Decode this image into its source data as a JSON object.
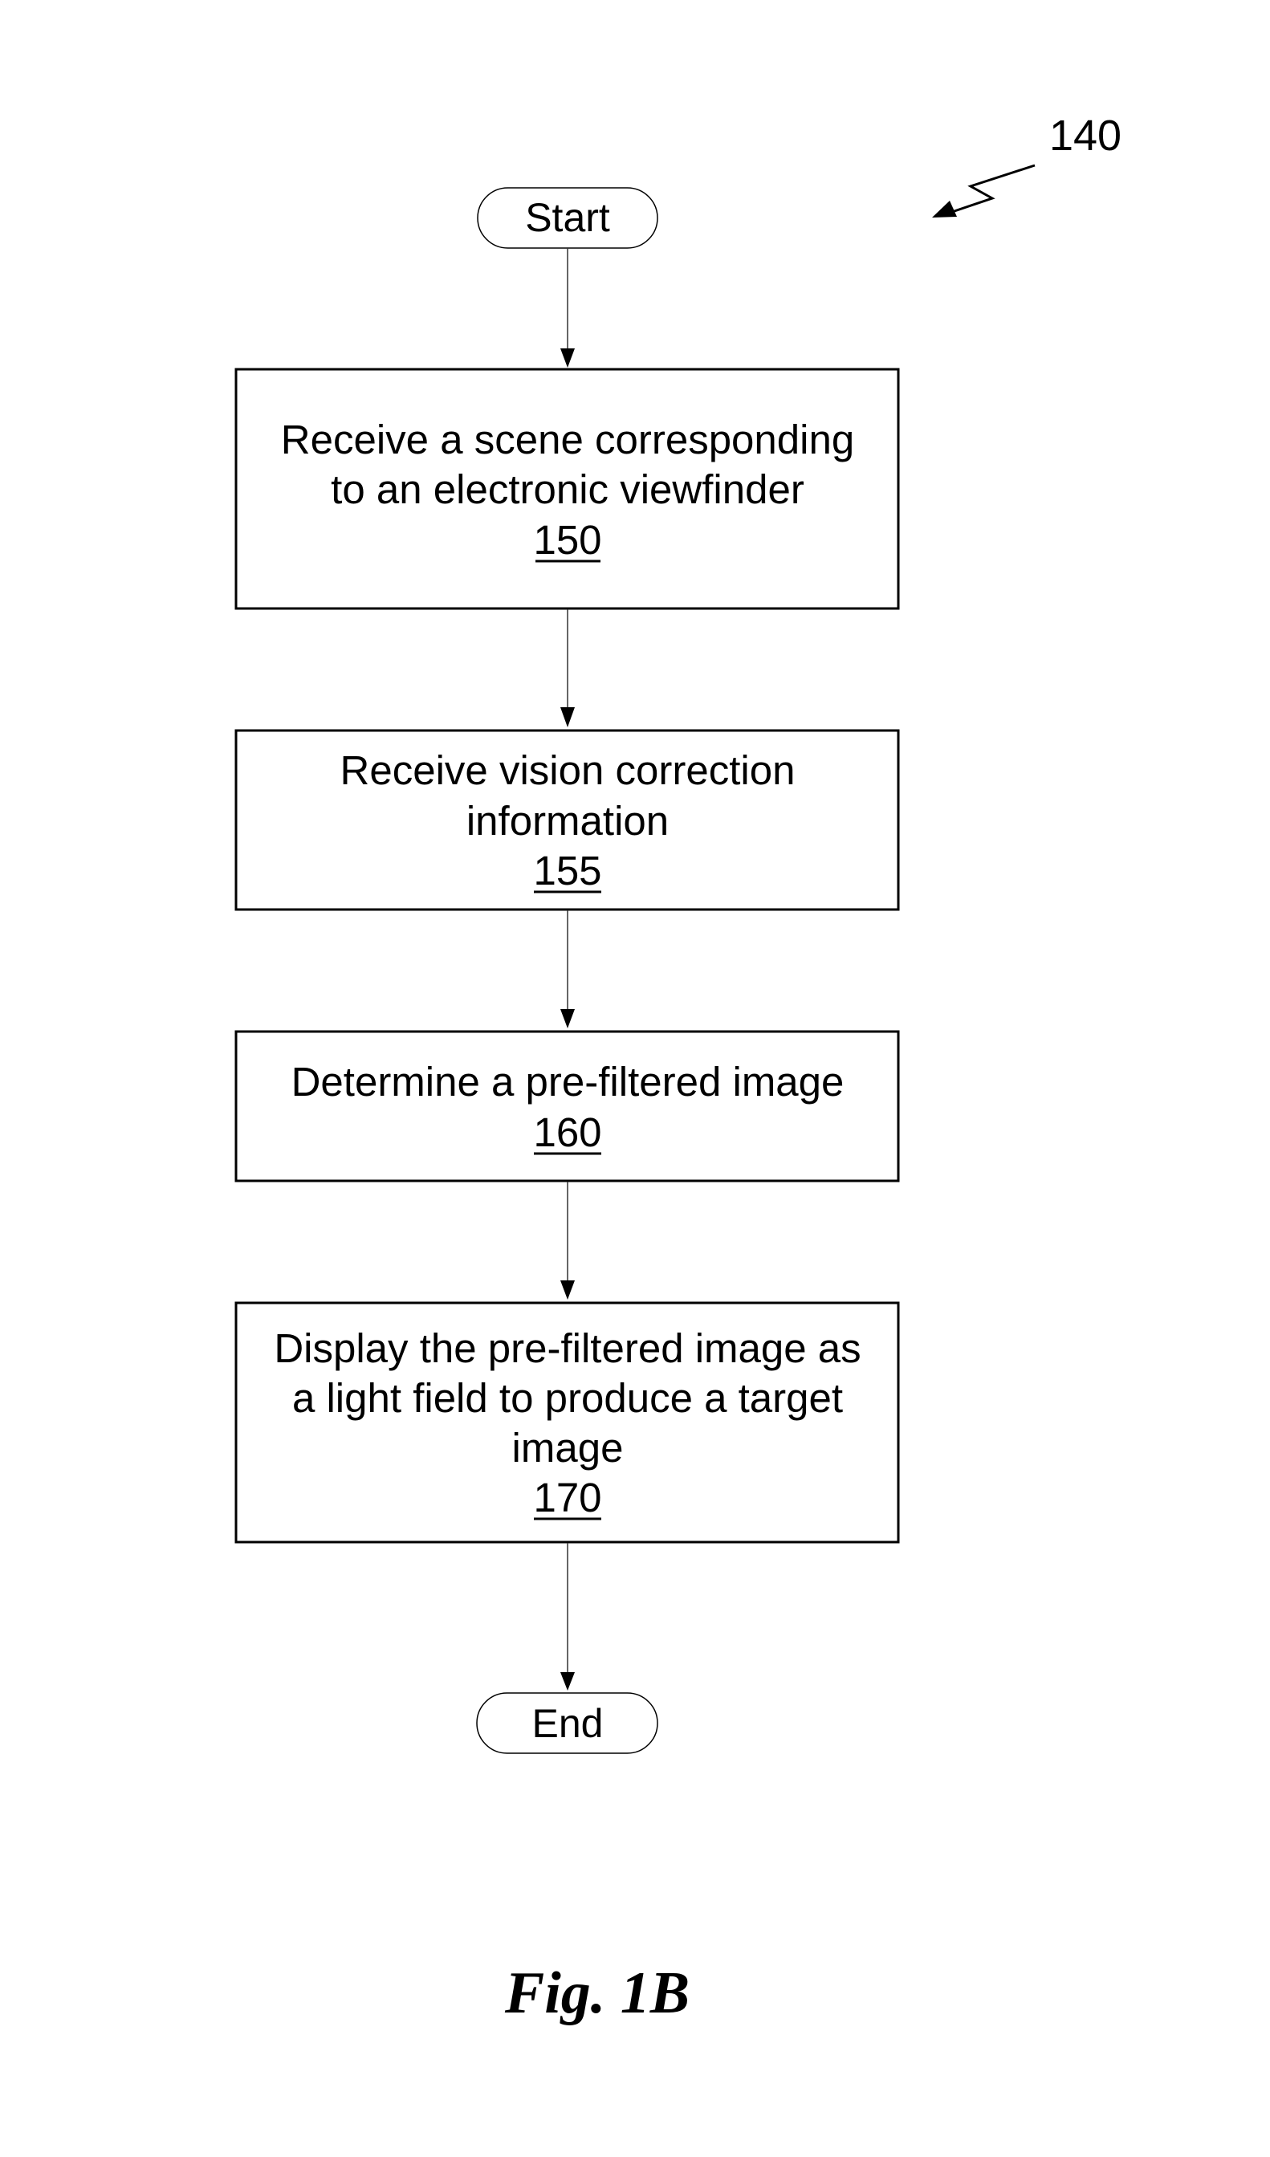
{
  "figure": {
    "reference_label": "140",
    "caption": "Fig. 1B"
  },
  "flowchart": {
    "start": {
      "label": "Start"
    },
    "end": {
      "label": "End"
    },
    "steps": [
      {
        "lines": [
          "Receive a scene corresponding",
          "to an electronic viewfinder"
        ],
        "ref": "150"
      },
      {
        "lines": [
          "Receive vision correction",
          "information"
        ],
        "ref": "155"
      },
      {
        "lines": [
          "Determine a pre-filtered image"
        ],
        "ref": "160"
      },
      {
        "lines": [
          "Display the pre-filtered image as",
          "a light field to produce a target",
          "image"
        ],
        "ref": "170"
      }
    ],
    "edges": [
      {
        "from": "start",
        "to": "150"
      },
      {
        "from": "150",
        "to": "155"
      },
      {
        "from": "155",
        "to": "160"
      },
      {
        "from": "160",
        "to": "170"
      },
      {
        "from": "170",
        "to": "end"
      }
    ]
  }
}
